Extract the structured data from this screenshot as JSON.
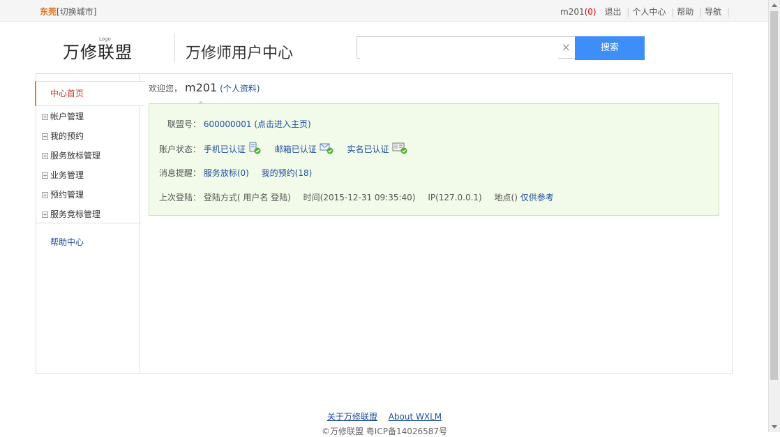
{
  "topbar": {
    "city": "东莞",
    "switch_city": "[切换城市]",
    "username": "m201",
    "msg_count": "(0)",
    "logout": "退出",
    "user_center": "个人中心",
    "help": "帮助",
    "nav": "导航"
  },
  "header": {
    "logo_text": "万修联盟",
    "logo_small": "Logo",
    "title": "万修师用户中心",
    "search_placeholder": "",
    "search_clear": "×",
    "search_button": "搜索"
  },
  "sidebar": {
    "active": "中心首页",
    "items": [
      {
        "label": "帐户管理"
      },
      {
        "label": "我的预约"
      },
      {
        "label": "服务放标管理"
      },
      {
        "label": "业务管理"
      },
      {
        "label": "预约管理"
      },
      {
        "label": "服务竞标管理"
      }
    ],
    "expand_symbol": "+",
    "help_center": "帮助中心"
  },
  "content": {
    "welcome_prefix": "欢迎您，",
    "welcome_user": "m201",
    "profile_link": "(个人资料)",
    "member_label": "联盟号：",
    "member_value": "600000001 (点击进入主页)",
    "status_label": "账户状态：",
    "phone_verified": "手机已认证",
    "email_verified": "邮箱已认证",
    "realname_verified": "实名已认证",
    "msg_label": "消息提醒：",
    "msg_bids": "服务放标(0)",
    "msg_appointments": "我的预约(18)",
    "last_login_label": "上次登陆：",
    "login_method": "登陆方式( 用户名 登陆)",
    "login_time": "时间(2015-12-31 09:35:40)",
    "login_ip": "IP(127.0.0.1)",
    "login_place": "地点()",
    "login_ref": "仅供参考"
  },
  "footer": {
    "about_cn": "关于万修联盟",
    "about_en": "About WXLM",
    "copyright": "©万修联盟 粤ICP备14026587号"
  }
}
